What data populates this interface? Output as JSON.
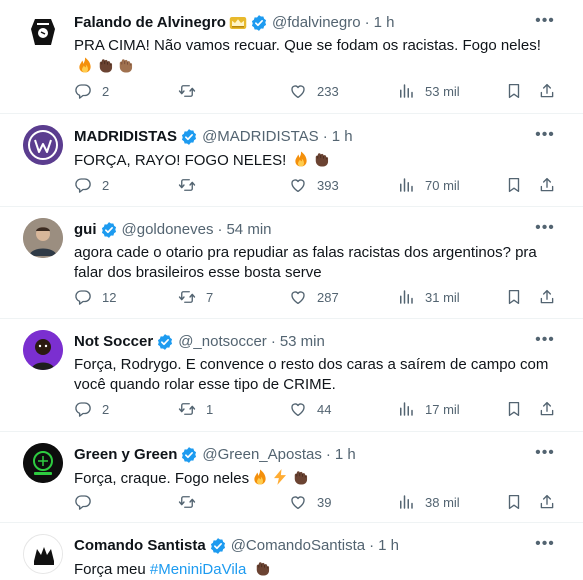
{
  "tweets": [
    {
      "name": "Falando de Alvinegro",
      "handle": "@fdalvinegro",
      "time": "1 h",
      "text": "PRA CIMA! Não vamos recuar. Que se fodam os racistas. Fogo neles!",
      "replies": "2",
      "retweets": "",
      "likes": "233",
      "views": "53 mil"
    },
    {
      "name": "MADRIDISTAS",
      "handle": "@MADRIDISTAS",
      "time": "1 h",
      "text": "FORÇA, RAYO! FOGO NELES!",
      "replies": "2",
      "retweets": "",
      "likes": "393",
      "views": "70 mil"
    },
    {
      "name": "gui",
      "handle": "@goldoneves",
      "time": "54 min",
      "text": "agora cade o otario pra repudiar as falas racistas dos argentinos? pra falar dos brasileiros esse bosta serve",
      "replies": "12",
      "retweets": "7",
      "likes": "287",
      "views": "31 mil"
    },
    {
      "name": "Not Soccer",
      "handle": "@_notsoccer",
      "time": "53 min",
      "text": "Força, Rodrygo. E convence o resto dos caras a saírem de campo com você quando rolar esse tipo de CRIME.",
      "replies": "2",
      "retweets": "1",
      "likes": "44",
      "views": "17 mil"
    },
    {
      "name": "Green y Green",
      "handle": "@Green_Apostas",
      "time": "1 h",
      "text": "Força, craque. Fogo neles",
      "replies": "",
      "retweets": "",
      "likes": "39",
      "views": "38 mil"
    },
    {
      "name": "Comando Santista",
      "handle": "@ComandoSantista",
      "time": "1 h",
      "text": "Força meu",
      "hashtag": "#MeniniDaVila"
    }
  ],
  "colors": {
    "text": "#0f1419",
    "secondary": "#536471",
    "verified": "#1d9bf0",
    "divider": "#eff3f4",
    "gold_badge": "#e8b92c"
  },
  "icons": [
    "reply-icon",
    "retweet-icon",
    "like-icon",
    "views-icon",
    "bookmark-icon",
    "share-icon",
    "verified-icon",
    "more-icon",
    "fire-emoji",
    "fist-emoji",
    "lightning-emoji"
  ]
}
